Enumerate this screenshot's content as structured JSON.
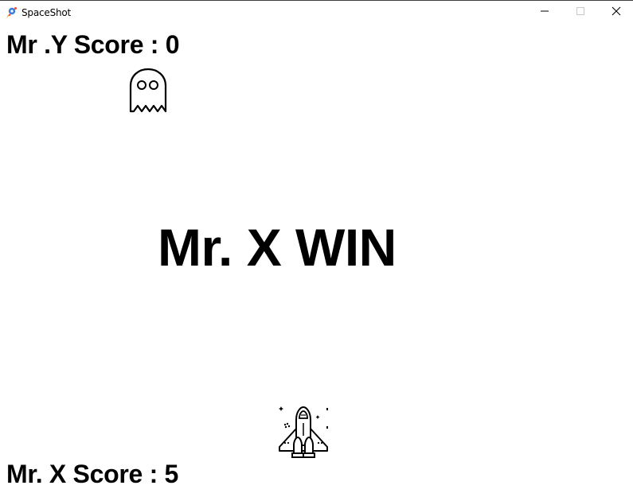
{
  "window": {
    "title": "SpaceShot",
    "app_icon": "rocket-icon",
    "controls": [
      "minimize-icon",
      "maximize-icon",
      "close-icon"
    ]
  },
  "game": {
    "player_y_score_text": "Mr .Y Score : 0",
    "player_x_score_text": "Mr. X Score : 5",
    "result_text": "Mr. X WIN",
    "enemy_sprite": "ghost-icon",
    "player_sprite": "spaceship-icon"
  },
  "colors": {
    "background": "#ffffff",
    "text": "#000000"
  }
}
